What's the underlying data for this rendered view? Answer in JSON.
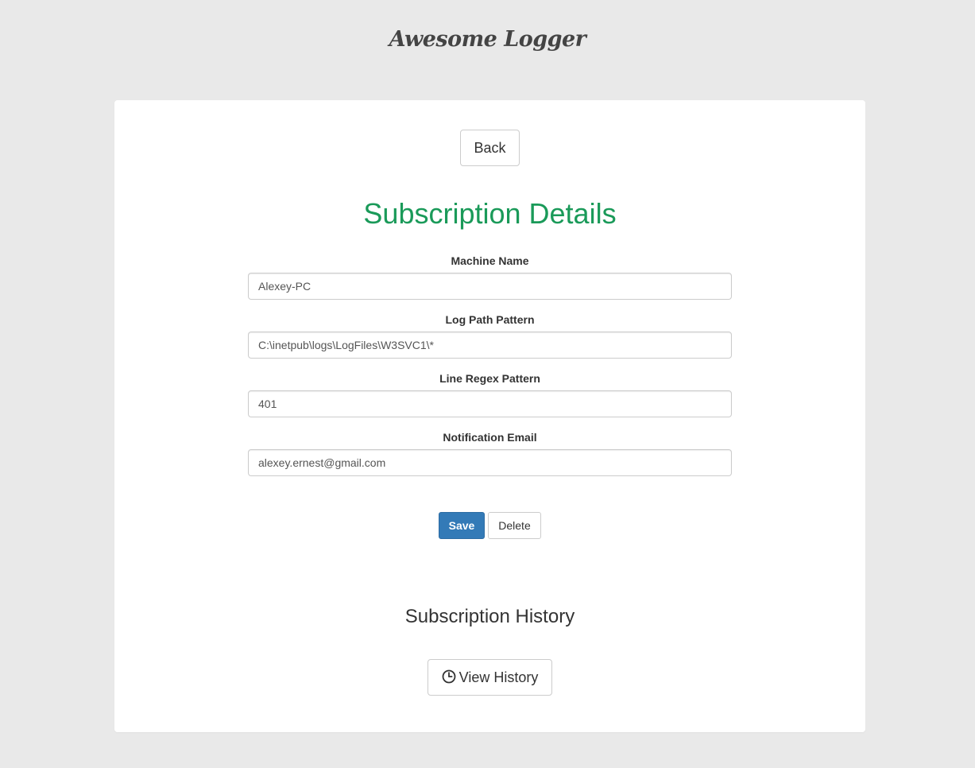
{
  "app": {
    "title": "Awesome Logger"
  },
  "card": {
    "back_label": "Back",
    "title": "Subscription Details",
    "fields": [
      {
        "label": "Machine Name",
        "value": "Alexey-PC"
      },
      {
        "label": "Log Path Pattern",
        "value": "C:\\inetpub\\logs\\LogFiles\\W3SVC1\\*"
      },
      {
        "label": "Line Regex Pattern",
        "value": "401"
      },
      {
        "label": "Notification Email",
        "value": "alexey.ernest@gmail.com"
      }
    ],
    "save_label": "Save",
    "delete_label": "Delete",
    "history_title": "Subscription History",
    "view_history_label": "View History",
    "view_history_icon": "clock-icon"
  },
  "colors": {
    "background": "#e9e9e9",
    "card": "#ffffff",
    "title_green": "#1a9a59",
    "primary_blue": "#337ab7"
  }
}
